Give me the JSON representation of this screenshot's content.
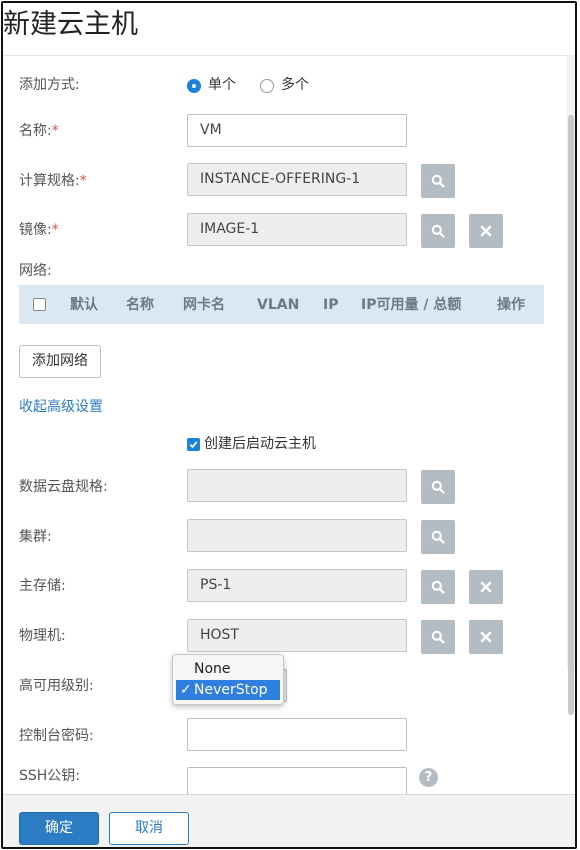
{
  "dialog": {
    "title": "新建云主机"
  },
  "form": {
    "add_mode": {
      "label": "添加方式:",
      "options": [
        "单个",
        "多个"
      ],
      "selected": "单个"
    },
    "name": {
      "label": "名称:",
      "required_mark": "*",
      "value": "VM"
    },
    "instance_offering": {
      "label": "计算规格:",
      "required_mark": "*",
      "value": "INSTANCE-OFFERING-1"
    },
    "image": {
      "label": "镜像:",
      "required_mark": "*",
      "value": "IMAGE-1"
    },
    "network": {
      "label": "网络:",
      "columns": [
        "默认",
        "名称",
        "网卡名",
        "VLAN",
        "IP",
        "IP可用量 / 总额",
        "操作"
      ],
      "add_button": "添加网络"
    },
    "advanced_toggle": "收起高级设置",
    "start_after_create": {
      "label": "创建后启动云主机",
      "checked": true
    },
    "data_disk_offering": {
      "label": "数据云盘规格:",
      "value": ""
    },
    "cluster": {
      "label": "集群:",
      "value": ""
    },
    "primary_storage": {
      "label": "主存储:",
      "value": "PS-1"
    },
    "host": {
      "label": "物理机:",
      "value": "HOST"
    },
    "ha_level": {
      "label": "高可用级别:",
      "options": [
        "None",
        "NeverStop"
      ],
      "selected": "NeverStop",
      "check_mark": "✓"
    },
    "console_password": {
      "label": "控制台密码:",
      "value": ""
    },
    "ssh_key": {
      "label": "SSH公钥:",
      "value": "",
      "help_mark": "?"
    }
  },
  "footer": {
    "confirm": "确定",
    "cancel": "取消"
  },
  "colors": {
    "primary": "#2b7cc2",
    "icon_button": "#b3bcc3",
    "required": "#d9534f",
    "table_header": "#dbe8f3"
  },
  "icons": {
    "search": "search-icon",
    "clear": "close-icon",
    "help": "help-icon"
  }
}
